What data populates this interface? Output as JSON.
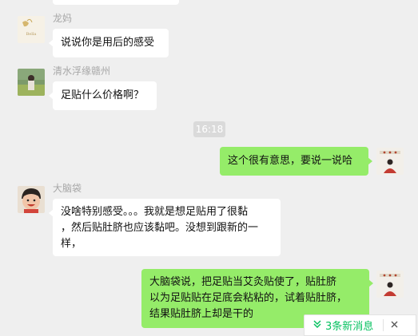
{
  "messages": [
    {
      "sender": "龙妈",
      "text": "说说你是用后的感受"
    },
    {
      "sender": "清水浮缘赣州",
      "text": "足贴什么价格啊？"
    },
    {
      "time": "16:18"
    },
    {
      "sender": "me",
      "text": "这个很有意思，要说一说哈"
    },
    {
      "sender": "大脑袋",
      "lines": [
        "没啥特别感受。。。我就是想足贴用了很黏",
        "，然后贴肚脐也应该黏吧。没想到跟新的一",
        "样，"
      ]
    },
    {
      "sender": "me",
      "lines": [
        "大脑袋说，把足贴当艾灸贴使了，贴肚脐",
        "以为足贴贴在足底会粘粘的，试着贴肚脐，",
        "结果贴肚脐上却是干的"
      ]
    }
  ],
  "new_messages": {
    "label": "3条新消息"
  },
  "icons": {
    "new_messages_arrow": "chevron-down-double-icon",
    "close": "close-icon"
  },
  "colors": {
    "my_bubble": "#95ec69",
    "their_bubble": "#ffffff",
    "background": "#efefef",
    "accent": "#07c160"
  }
}
